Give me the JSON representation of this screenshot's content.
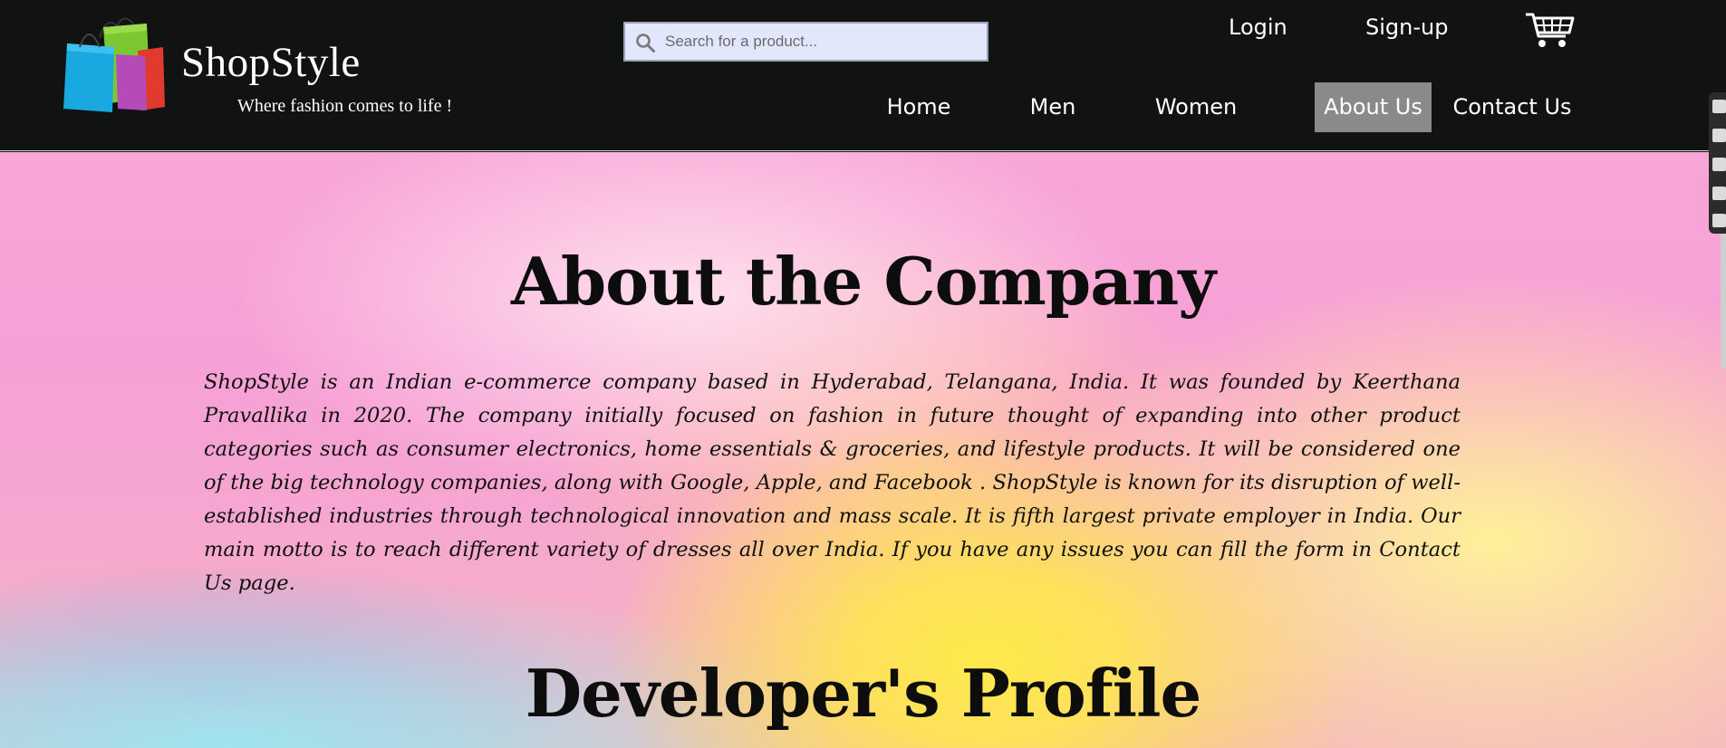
{
  "brand": {
    "name": "ShopStyle",
    "tagline": "Where fashion comes to life !",
    "logo_icon": "shopping-bags-icon"
  },
  "search": {
    "placeholder": "Search for a product...",
    "value": "",
    "icon": "search-icon"
  },
  "account": {
    "login_label": "Login",
    "signup_label": "Sign-up",
    "cart_icon": "cart-icon"
  },
  "nav": {
    "items": [
      {
        "label": "Home",
        "active": false
      },
      {
        "label": "Men",
        "active": false
      },
      {
        "label": "Women",
        "active": false
      },
      {
        "label": "About Us",
        "active": true
      },
      {
        "label": "Contact Us",
        "active": false
      }
    ]
  },
  "about": {
    "title": "About the Company",
    "body": "ShopStyle is an Indian e-commerce company based in Hyderabad, Telangana, India. It was founded by Keerthana Pravallika in 2020. The company initially focused on fashion in future thought of expanding into other product categories such as consumer electronics, home essentials & groceries, and lifestyle products. It will be considered one of the big technology companies, along with Google, Apple, and Facebook . ShopStyle is known for its disruption of well-established industries through technological innovation and mass scale. It is fifth largest private employer in India. Our main motto is to reach different variety of dresses all over India. If you have any issues you can fill the form in Contact Us page."
  },
  "developer": {
    "title": "Developer's Profile"
  },
  "colors": {
    "header_bg": "#111312",
    "active_nav_bg": "#8a8a8a",
    "search_bg": "#e3e7fb",
    "text": "#0d0d0d"
  }
}
